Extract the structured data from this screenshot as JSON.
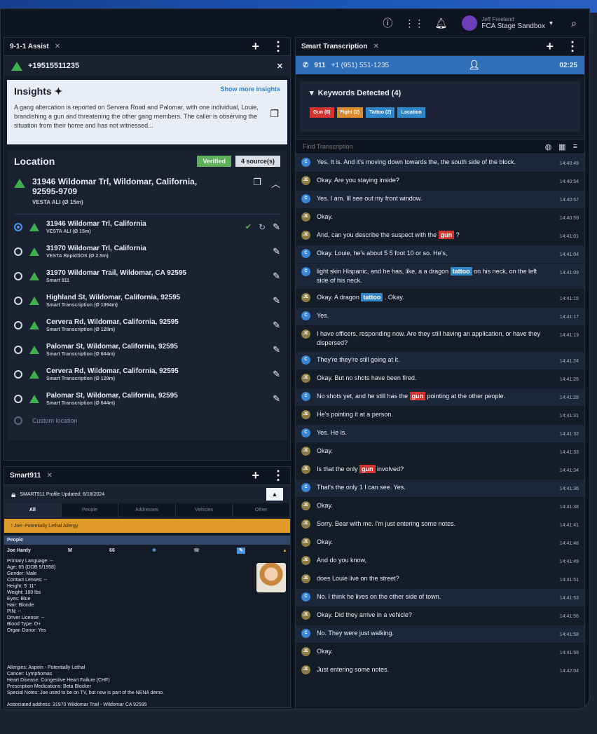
{
  "topbar": {
    "user_line1": "Jeff Freeland",
    "user_line2": "FCA Stage Sandbox"
  },
  "assist": {
    "tab": "9-1-1 Assist",
    "phone": "+19515511235",
    "insights_title": "Insights",
    "show_more": "Show more insights",
    "insights_text": "A gang altercation is reported on Servera Road and Palomar, with one individual, Louie, brandishing a gun and threatening the other gang members. The caller is observing the situation from their home and has not witnessed...",
    "location_title": "Location",
    "verified": "Verified",
    "sources": "4 source(s)",
    "primary_address": "31946 Wildomar Trl, Wildomar, California, 92595-9709",
    "primary_sub": "VESTA ALI (Ø 15m)",
    "locations": [
      {
        "address": "31946 Wildomar Trl, California",
        "sub": "VESTA ALI (Ø 15m)"
      },
      {
        "address": "31970 Wildomar Trl, California",
        "sub": "VESTA RapidSOS (Ø 2.5m)"
      },
      {
        "address": "31970 Wildomar Trail, Wildomar, CA 92595",
        "sub": "Smart 911"
      },
      {
        "address": "Highland St, Wildomar, California, 92595",
        "sub": "Smart Transcription (Ø 1994m)"
      },
      {
        "address": "Cervera Rd, Wildomar, California, 92595",
        "sub": "Smart Transcription (Ø 128m)"
      },
      {
        "address": "Palomar St, Wildomar, California, 92595",
        "sub": "Smart Transcription (Ø 644m)"
      },
      {
        "address": "Cervera Rd, Wildomar, California, 92595",
        "sub": "Smart Transcription (Ø 128m)"
      },
      {
        "address": "Palomar St, Wildomar, California, 92595",
        "sub": "Smart Transcription (Ø 644m)"
      }
    ],
    "custom_location": "Custom location"
  },
  "smart911": {
    "tab": "Smart911",
    "profile": "SMART911 Profile",
    "updated": "Updated: 6/18/2024",
    "tabs": [
      "All",
      "People",
      "Addresses",
      "Vehicles",
      "Other"
    ],
    "allergy": "Joe: Potentially Lethal Allergy",
    "people_header": "People",
    "person_name": "Joe Hardy",
    "person_sex": "M",
    "person_age": "66",
    "details": [
      "Primary Language: --",
      "Age: 65 (DOB 9/1958)",
      "Gender: Male",
      "Contact Lenses: --",
      "Height: 5' 11\"",
      "Weight: 180 lbs",
      "Eyes: Blue",
      "Hair: Blonde",
      "PIN: --",
      "Driver License: --",
      "Blood Type: O+",
      "Organ Donor: Yes"
    ],
    "medical": [
      "Allergies: Aspirin - Potentially Lethal",
      "Cancer: Lymphomas",
      "Heart Disease: Congestive Heart Failure (CHF)",
      "Prescription Medications: Beta Blocker",
      "Special Notes: Joe used to be on TV, but now is part of the NENA demo."
    ],
    "address": "Associated address: 31970 Wildomar Trail - Wildomar CA 92595"
  },
  "transcription": {
    "tab": "Smart Transcription",
    "call_label": "911",
    "call_number": "+1 (951) 551-1235",
    "call_time": "02:25",
    "keywords_title": "Keywords Detected (4)",
    "chips": [
      {
        "label": "Gun (6)",
        "color": "#d2342f"
      },
      {
        "label": "Fight (2)",
        "color": "#d98a2a"
      },
      {
        "label": "Tattoo (2)",
        "color": "#2f86c8"
      },
      {
        "label": "Location",
        "color": "#2f86c8"
      }
    ],
    "find_placeholder": "Find Transcription",
    "messages": [
      {
        "who": "C",
        "text": "Yes. It is. And it's moving down towards the, the south side of the block.",
        "time": "14:40:49"
      },
      {
        "who": "JE",
        "text": "Okay. Are you staying inside?",
        "time": "14:40:54"
      },
      {
        "who": "C",
        "text": "Yes. I am. Ill see out my front window.",
        "time": "14:40:57"
      },
      {
        "who": "JE",
        "text": "Okay.",
        "time": "14:40:59"
      },
      {
        "who": "JE",
        "text": "And, can you describe the suspect with the",
        "kw": "gun",
        "kwc": "red",
        "after": "?",
        "time": "14:41:01"
      },
      {
        "who": "C",
        "text": "Okay. Louie, he's about 5 5 foot 10 or so. He's,",
        "time": "14:41:04"
      },
      {
        "who": "C",
        "text": "light skin Hispanic, and he has, like, a a dragon",
        "kw": "tattoo",
        "kwc": "blue",
        "after": "on his neck, on the left side of his neck.",
        "time": "14:41:09"
      },
      {
        "who": "JE",
        "text": "Okay. A dragon",
        "kw": "tattoo",
        "kwc": "blue",
        "after": ". Okay.",
        "time": "14:41:15"
      },
      {
        "who": "C",
        "text": "Yes.",
        "time": "14:41:17"
      },
      {
        "who": "JE",
        "text": "I have officers, responding now. Are they still having an application, or have they dispersed?",
        "time": "14:41:19"
      },
      {
        "who": "C",
        "text": "They're they're still going at it.",
        "time": "14:41:24"
      },
      {
        "who": "JE",
        "text": "Okay. But no shots have been fired.",
        "time": "14:41:26"
      },
      {
        "who": "C",
        "text": "No shots yet, and he still has the",
        "kw": "gun",
        "kwc": "red",
        "after": "pointing at the other people.",
        "time": "14:41:28"
      },
      {
        "who": "JE",
        "text": "He's pointing it at a person.",
        "time": "14:41:31"
      },
      {
        "who": "C",
        "text": "Yes. He is.",
        "time": "14:41:32"
      },
      {
        "who": "JE",
        "text": "Okay.",
        "time": "14:41:33"
      },
      {
        "who": "JE",
        "text": "Is that the only",
        "kw": "gun",
        "kwc": "red",
        "after": "involved?",
        "time": "14:41:34"
      },
      {
        "who": "C",
        "text": "That's the only 1 I can see. Yes.",
        "time": "14:41:36"
      },
      {
        "who": "JE",
        "text": "Okay.",
        "time": "14:41:38"
      },
      {
        "who": "JE",
        "text": "Sorry. Bear with me. I'm just entering some notes.",
        "time": "14:41:41"
      },
      {
        "who": "JE",
        "text": "Okay.",
        "time": "14:41:48"
      },
      {
        "who": "JE",
        "text": "And do you know,",
        "time": "14:41:49"
      },
      {
        "who": "JE",
        "text": "does Louie live on the street?",
        "time": "14:41:51"
      },
      {
        "who": "C",
        "text": "No. I think he lives on the other side of town.",
        "time": "14:41:53"
      },
      {
        "who": "JE",
        "text": "Okay. Did they arrive in a vehicle?",
        "time": "14:41:56"
      },
      {
        "who": "C",
        "text": "No. They were just walking.",
        "time": "14:41:58"
      },
      {
        "who": "JE",
        "text": "Okay.",
        "time": "14:41:59"
      },
      {
        "who": "JE",
        "text": "Just entering some notes.",
        "time": "14:42:04"
      }
    ]
  }
}
